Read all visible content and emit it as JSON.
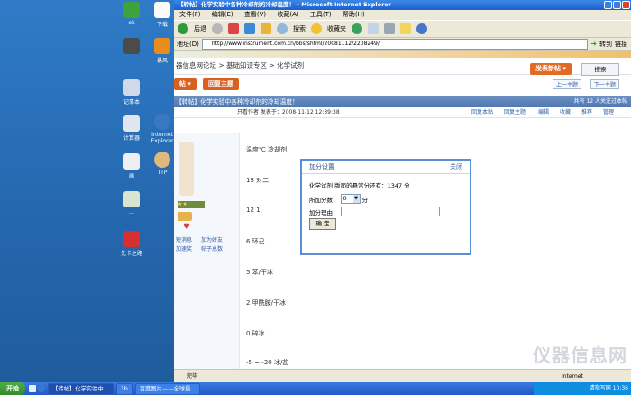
{
  "desktop": {
    "icons": [
      {
        "label": "ok",
        "color": "#3ea33a"
      },
      {
        "label": "...",
        "color": "#4b4b4b"
      },
      {
        "label": "下载",
        "color": "#fafafa"
      },
      {
        "label": "暴风",
        "color": "#e88c1e"
      },
      {
        "label": "记事本",
        "color": "#cfd9e8"
      },
      {
        "label": "Internet Explorer",
        "color": "#3a78c6"
      },
      {
        "label": "计算器",
        "color": "#dfe6ee"
      },
      {
        "label": "TTP",
        "color": "#e0b77c"
      },
      {
        "label": "画",
        "color": "#eceff3"
      },
      {
        "label": "...",
        "color": "#d9e5d0"
      },
      {
        "label": "先卡之路",
        "color": "#d63031"
      }
    ]
  },
  "window": {
    "title": "【转帖】化学实验中各种冷却剂的冷却温度！ - Microsoft Internet Explorer",
    "menu": [
      "文件(F)",
      "编辑(E)",
      "查看(V)",
      "收藏(A)",
      "工具(T)",
      "帮助(H)"
    ],
    "toolbar": {
      "back": "后退",
      "search": "搜索",
      "favorites": "收藏夹"
    },
    "address_label": "地址(D)",
    "address": "http://www.instrument.com.cn/bbs/shtml/20081112/2208249/",
    "go_label": "转到",
    "links_label": "链接"
  },
  "page": {
    "breadcrumb": "器信息网论坛 > 基础知识专区 > 化学试剂",
    "new_post_btn": "发表新帖",
    "reply_btn": "回复主题",
    "prev_thread": "上一主题",
    "next_thread": "下一主题",
    "thread_title": "【转帖】化学实验中各种冷却剂的冷却温度！",
    "thread_total": "共有 12 人关注过本帖",
    "post_meta": "只看作者  发表于：2008-11-12 12:39:38",
    "post_actions": [
      "回复本贴",
      "回复主题",
      "编辑",
      "收藏",
      "推荐",
      "管理"
    ],
    "user_side": {
      "send_msg": "短消息",
      "add_friend": "加为好友",
      "rate": "加速奖",
      "post_count": "帖子总数"
    },
    "lines": [
      "温度℃  冷却剂",
      "13 对二",
      "12  1,",
      "6 环己",
      "5 苯/干冰",
      "2 甲酰胺/干冰",
      "0 碎冰",
      "-5 ~ -20 冰/盐"
    ]
  },
  "dialog": {
    "title": "加分设置",
    "close": "关闭",
    "info": "化学试剂  版面的悬赏分还有：1347 分",
    "score_label": "所加分数：",
    "score_value": "0",
    "score_unit": "分",
    "reason_label": "加分理由：",
    "ok": "确 定"
  },
  "statusbar": {
    "status": "完毕",
    "zone": "Internet"
  },
  "taskbar": {
    "start": "开始",
    "tasks": [
      "【转帖】化学实验中...",
      "3b",
      "百度图片——全球最..."
    ],
    "tray_text": "请指写网 10:36"
  },
  "watermark": "仪器信息网"
}
